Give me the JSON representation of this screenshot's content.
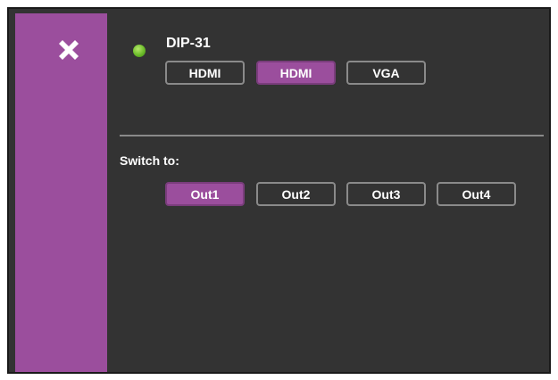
{
  "device": {
    "name": "DIP-31",
    "status_color": "#6cbc2a"
  },
  "inputs": [
    {
      "label": "HDMI",
      "selected": false
    },
    {
      "label": "HDMI",
      "selected": true
    },
    {
      "label": "VGA",
      "selected": false
    }
  ],
  "switch": {
    "label": "Switch to:",
    "outputs": [
      {
        "label": "Out1",
        "selected": true
      },
      {
        "label": "Out2",
        "selected": false
      },
      {
        "label": "Out3",
        "selected": false
      },
      {
        "label": "Out4",
        "selected": false
      }
    ]
  },
  "colors": {
    "accent": "#9b4e9d",
    "panel_bg": "#333333",
    "button_border": "#8a8a8a",
    "text": "#ffffff"
  },
  "icons": {
    "close": "close-icon"
  }
}
